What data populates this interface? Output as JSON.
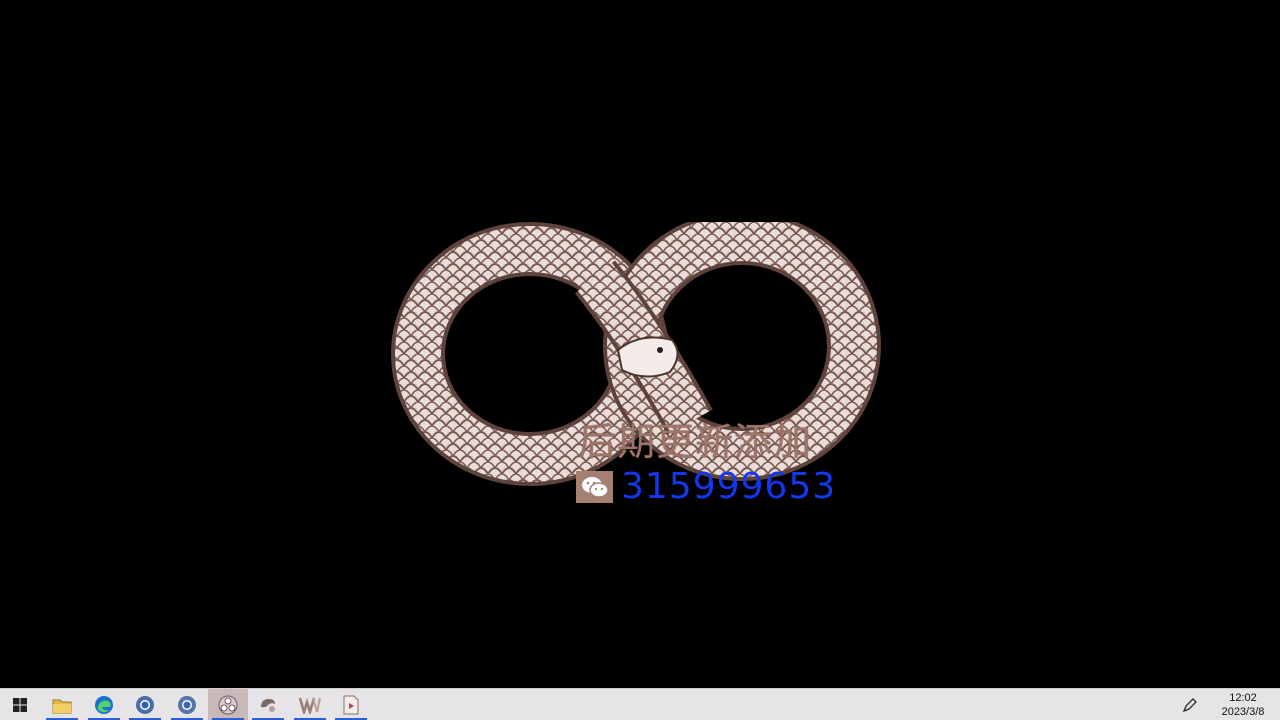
{
  "desktop": {
    "wallpaper_icon": "ouroboros-infinity-snake",
    "overlay_title": "后期更新添加",
    "contact_icon": "wechat-icon",
    "contact_number": "315999653",
    "colors": {
      "background": "#000000",
      "title": "#9c7468",
      "number": "#1437ee",
      "snake_light": "#f1e6e3",
      "snake_dark": "#8e6a61"
    }
  },
  "taskbar": {
    "start_icon": "windows-logo-icon",
    "apps": [
      {
        "icon": "file-explorer-icon",
        "running": true
      },
      {
        "icon": "edge-browser-icon",
        "running": true
      },
      {
        "icon": "chrome-browser-icon",
        "running": true
      },
      {
        "icon": "chrome-browser-icon",
        "running": true
      },
      {
        "icon": "obs-studio-icon",
        "running": true,
        "active": true
      },
      {
        "icon": "qq-music-icon",
        "running": true
      },
      {
        "icon": "wps-writer-icon",
        "running": true
      },
      {
        "icon": "media-player-icon",
        "running": true
      }
    ],
    "tray": {
      "pen_icon": "pen-workspace-icon",
      "time": "12:02",
      "date": "2023/3/8"
    }
  }
}
